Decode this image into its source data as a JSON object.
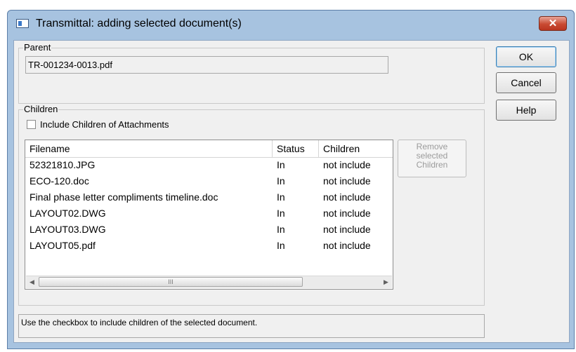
{
  "window": {
    "title": "Transmittal: adding selected document(s)",
    "close_glyph": "✕"
  },
  "parent": {
    "label": "Parent",
    "value": "TR-001234-0013.pdf"
  },
  "children": {
    "label": "Children",
    "include_checkbox_label": "Include Children of Attachments",
    "include_checked": false,
    "columns": [
      "Filename",
      "Status",
      "Children"
    ],
    "rows": [
      {
        "filename": "52321810.JPG",
        "status": "In",
        "children": "not include"
      },
      {
        "filename": "ECO-120.doc",
        "status": "In",
        "children": "not include"
      },
      {
        "filename": "Final phase letter compliments timeline.doc",
        "status": "In",
        "children": "not include"
      },
      {
        "filename": "LAYOUT02.DWG",
        "status": "In",
        "children": "not include"
      },
      {
        "filename": "LAYOUT03.DWG",
        "status": "In",
        "children": "not include"
      },
      {
        "filename": "LAYOUT05.pdf",
        "status": "In",
        "children": "not include"
      }
    ],
    "remove_button_line1": "Remove",
    "remove_button_line2": "selected",
    "remove_button_line3": "Children"
  },
  "buttons": {
    "ok": "OK",
    "cancel": "Cancel",
    "help": "Help"
  },
  "scrollbar": {
    "left_arrow": "◀",
    "right_arrow": "▶",
    "thumb_grip": "III"
  },
  "status_text": "Use the checkbox to include children of the selected document."
}
